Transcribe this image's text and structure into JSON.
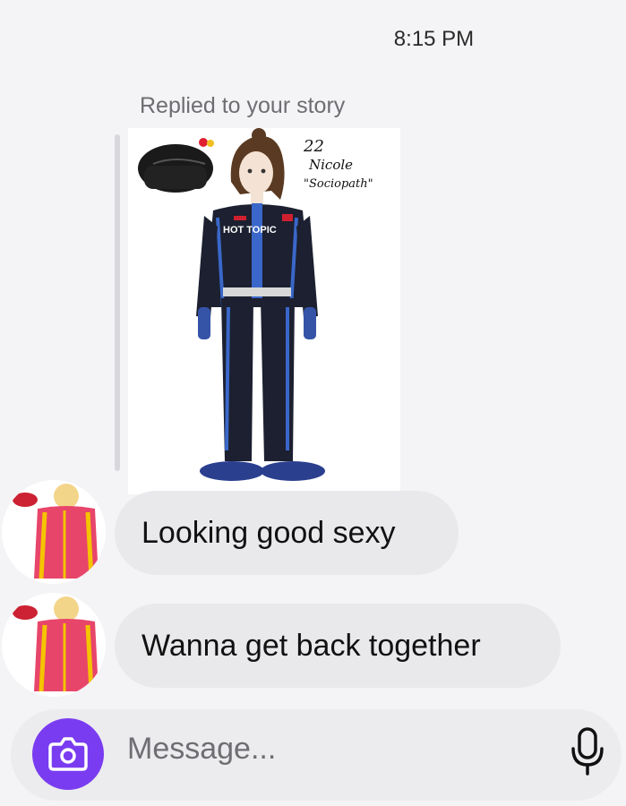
{
  "header": {
    "time": "8:15 PM"
  },
  "reply": {
    "label": "Replied to your story"
  },
  "story_image": {
    "number": "22",
    "name": "Nicole",
    "nickname": "\"Sociopath\"",
    "sponsor": "HOT TOPIC"
  },
  "messages": [
    {
      "text": "Looking good sexy"
    },
    {
      "text": "Wanna get back together"
    }
  ],
  "composer": {
    "placeholder": "Message...",
    "accent": "#7a3cf0"
  },
  "icons": [
    "camera-icon",
    "microphone-icon"
  ]
}
